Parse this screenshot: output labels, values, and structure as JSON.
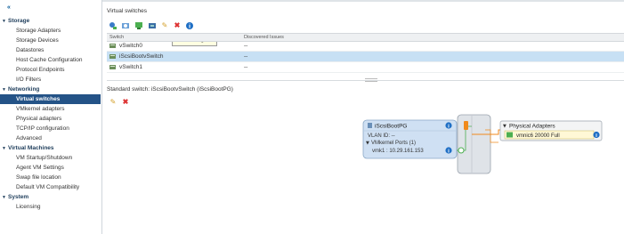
{
  "sidebar": {
    "collapse": "«",
    "sections": [
      {
        "label": "Storage",
        "items": [
          "Storage Adapters",
          "Storage Devices",
          "Datastores",
          "Host Cache Configuration",
          "Protocol Endpoints",
          "I/O Filters"
        ]
      },
      {
        "label": "Networking",
        "items": [
          "Virtual switches",
          "VMkernel adapters",
          "Physical adapters",
          "TCP/IP configuration",
          "Advanced"
        ]
      },
      {
        "label": "Virtual Machines",
        "items": [
          "VM Startup/Shutdown",
          "Agent VM Settings",
          "Swap file location",
          "Default VM Compatibility"
        ]
      },
      {
        "label": "System",
        "items": [
          "Licensing"
        ]
      }
    ],
    "selected": "Virtual switches"
  },
  "main": {
    "title": "Virtual switches",
    "tooltip": "Edit settings",
    "grid": {
      "col_switch": "Switch",
      "col_issues": "Discovered Issues",
      "rows": [
        {
          "name": "vSwitch0",
          "issues": "--"
        },
        {
          "name": "iScsiBootvSwitch",
          "issues": "--"
        },
        {
          "name": "vSwitch1",
          "issues": "--"
        }
      ]
    },
    "standard_switch_title": "Standard switch: iScsiBootvSwitch (iScsiBootPG)",
    "portgroup": {
      "name": "iScsiBootPG",
      "vlan": "VLAN ID: --",
      "ports": "VMkernel Ports (1)",
      "vmk": "vmk1 : 10.29.161.153"
    },
    "physical": {
      "title": "Physical Adapters",
      "nic": "vmnic6   20000  Full"
    }
  },
  "colors": {
    "accent": "#245387",
    "row_selected": "#c7e0f4",
    "portgroup_fill": "#cfe0f3",
    "link_orange": "#f08a1c",
    "nic_green": "#4caf50"
  }
}
